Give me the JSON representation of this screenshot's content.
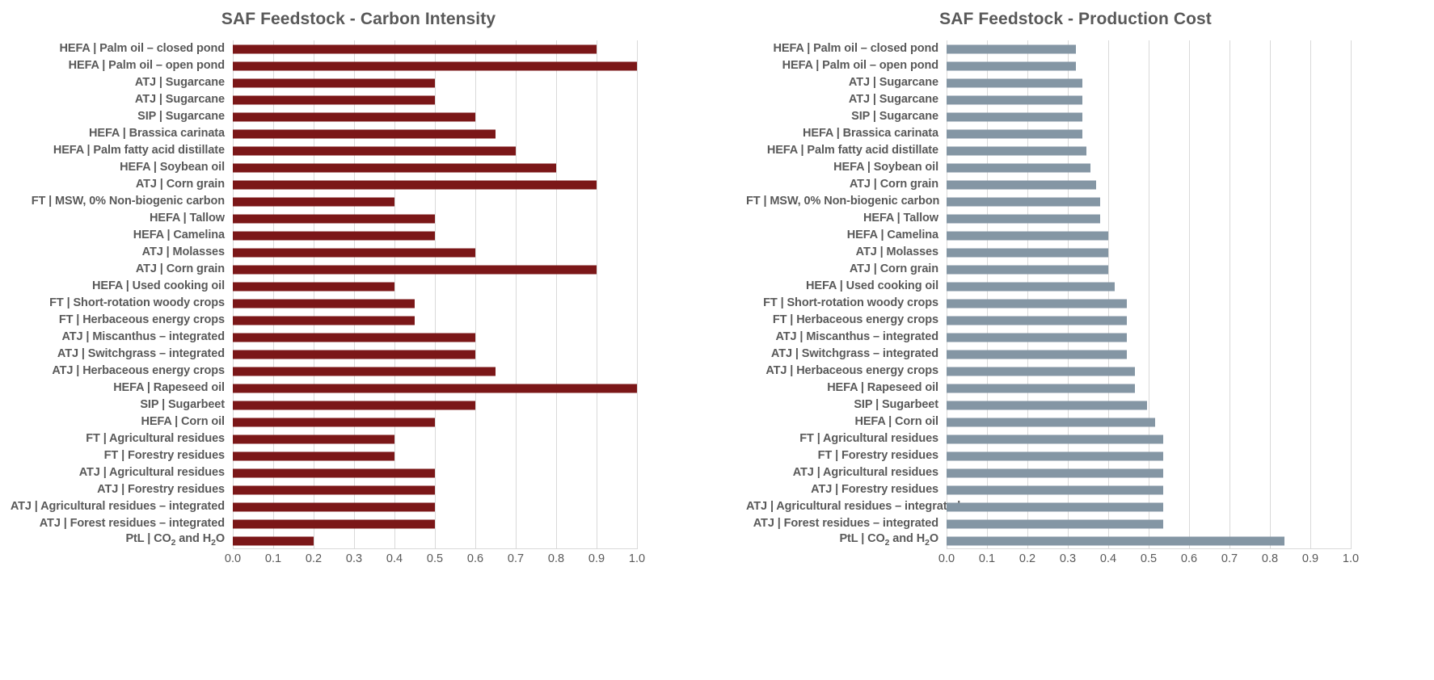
{
  "charts": [
    {
      "id": "carbon-intensity",
      "title": "SAF Feedstock - Carbon Intensity",
      "bar_color": "#7b1718",
      "xticks": [
        "0.0",
        "0.1",
        "0.2",
        "0.3",
        "0.4",
        "0.5",
        "0.6",
        "0.7",
        "0.8",
        "0.9",
        "1.0"
      ],
      "categories": [
        "HEFA | Palm oil – closed pond",
        "HEFA | Palm oil – open pond",
        "ATJ | Sugarcane",
        "ATJ | Sugarcane",
        "SIP | Sugarcane",
        "HEFA | Brassica carinata",
        "HEFA | Palm fatty acid distillate",
        "HEFA | Soybean oil",
        "ATJ | Corn grain",
        "FT | MSW, 0% Non-biogenic carbon",
        "HEFA | Tallow",
        "HEFA | Camelina",
        "ATJ | Molasses",
        "ATJ | Corn grain",
        "HEFA | Used cooking oil",
        "FT | Short-rotation woody crops",
        "FT | Herbaceous energy crops",
        "ATJ | Miscanthus – integrated",
        "ATJ | Switchgrass – integrated",
        "ATJ | Herbaceous energy crops",
        "HEFA | Rapeseed oil",
        "SIP | Sugarbeet",
        "HEFA | Corn oil",
        "FT | Agricultural residues",
        "FT | Forestry residues",
        "ATJ | Agricultural residues",
        "ATJ | Forestry residues",
        "ATJ | Agricultural residues – integrated",
        "ATJ | Forest residues – integrated",
        "PtL | CO₂ and H₂O"
      ],
      "values": [
        0.9,
        1.0,
        0.5,
        0.5,
        0.6,
        0.65,
        0.7,
        0.8,
        0.9,
        0.4,
        0.5,
        0.5,
        0.6,
        0.9,
        0.4,
        0.45,
        0.45,
        0.6,
        0.6,
        0.65,
        1.0,
        0.6,
        0.5,
        0.4,
        0.4,
        0.5,
        0.5,
        0.5,
        0.5,
        0.2
      ]
    },
    {
      "id": "production-cost",
      "title": "SAF Feedstock - Production Cost",
      "bar_color": "#8496a4",
      "xticks": [
        "0.0",
        "0.1",
        "0.2",
        "0.3",
        "0.4",
        "0.5",
        "0.6",
        "0.7",
        "0.8",
        "0.9",
        "1.0"
      ],
      "categories": [
        "HEFA | Palm oil – closed pond",
        "HEFA | Palm oil – open pond",
        "ATJ | Sugarcane",
        "ATJ | Sugarcane",
        "SIP | Sugarcane",
        "HEFA | Brassica carinata",
        "HEFA | Palm fatty acid distillate",
        "HEFA | Soybean oil",
        "ATJ | Corn grain",
        "FT | MSW, 0% Non-biogenic carbon",
        "HEFA | Tallow",
        "HEFA | Camelina",
        "ATJ | Molasses",
        "ATJ | Corn grain",
        "HEFA | Used cooking oil",
        "FT | Short-rotation woody crops",
        "FT | Herbaceous energy crops",
        "ATJ | Miscanthus – integrated",
        "ATJ | Switchgrass – integrated",
        "ATJ | Herbaceous energy crops",
        "HEFA | Rapeseed oil",
        "SIP | Sugarbeet",
        "HEFA | Corn oil",
        "FT | Agricultural residues",
        "FT | Forestry residues",
        "ATJ | Agricultural residues",
        "ATJ | Forestry residues",
        "ATJ | Agricultural residues – integrated",
        "ATJ | Forest residues – integrated",
        "PtL | CO₂ and H₂O"
      ],
      "values": [
        0.32,
        0.32,
        0.335,
        0.335,
        0.335,
        0.335,
        0.345,
        0.355,
        0.37,
        0.38,
        0.38,
        0.4,
        0.4,
        0.4,
        0.415,
        0.445,
        0.445,
        0.445,
        0.445,
        0.465,
        0.465,
        0.495,
        0.515,
        0.535,
        0.535,
        0.535,
        0.535,
        0.535,
        0.535,
        0.835
      ]
    }
  ],
  "chart_data": [
    {
      "type": "bar",
      "orientation": "horizontal",
      "title": "SAF Feedstock - Carbon Intensity",
      "xlabel": "",
      "ylabel": "",
      "xlim": [
        0.0,
        1.0
      ],
      "grid": true,
      "legend": "none",
      "series_color": "#7b1718",
      "categories": [
        "HEFA | Palm oil – closed pond",
        "HEFA | Palm oil – open pond",
        "ATJ | Sugarcane",
        "ATJ | Sugarcane",
        "SIP | Sugarcane",
        "HEFA | Brassica carinata",
        "HEFA | Palm fatty acid distillate",
        "HEFA | Soybean oil",
        "ATJ | Corn grain",
        "FT | MSW, 0% Non-biogenic carbon",
        "HEFA | Tallow",
        "HEFA | Camelina",
        "ATJ | Molasses",
        "ATJ | Corn grain",
        "HEFA | Used cooking oil",
        "FT | Short-rotation woody crops",
        "FT | Herbaceous energy crops",
        "ATJ | Miscanthus – integrated",
        "ATJ | Switchgrass – integrated",
        "ATJ | Herbaceous energy crops",
        "HEFA | Rapeseed oil",
        "SIP | Sugarbeet",
        "HEFA | Corn oil",
        "FT | Agricultural residues",
        "FT | Forestry residues",
        "ATJ | Agricultural residues",
        "ATJ | Forestry residues",
        "ATJ | Agricultural residues – integrated",
        "ATJ | Forest residues – integrated",
        "PtL | CO₂ and H₂O"
      ],
      "values": [
        0.9,
        1.0,
        0.5,
        0.5,
        0.6,
        0.65,
        0.7,
        0.8,
        0.9,
        0.4,
        0.5,
        0.5,
        0.6,
        0.9,
        0.4,
        0.45,
        0.45,
        0.6,
        0.6,
        0.65,
        1.0,
        0.6,
        0.5,
        0.4,
        0.4,
        0.5,
        0.5,
        0.5,
        0.5,
        0.2
      ],
      "xticks": [
        0.0,
        0.1,
        0.2,
        0.3,
        0.4,
        0.5,
        0.6,
        0.7,
        0.8,
        0.9,
        1.0
      ]
    },
    {
      "type": "bar",
      "orientation": "horizontal",
      "title": "SAF Feedstock - Production Cost",
      "xlabel": "",
      "ylabel": "",
      "xlim": [
        0.0,
        1.0
      ],
      "grid": true,
      "legend": "none",
      "series_color": "#8496a4",
      "categories": [
        "HEFA | Palm oil – closed pond",
        "HEFA | Palm oil – open pond",
        "ATJ | Sugarcane",
        "ATJ | Sugarcane",
        "SIP | Sugarcane",
        "HEFA | Brassica carinata",
        "HEFA | Palm fatty acid distillate",
        "HEFA | Soybean oil",
        "ATJ | Corn grain",
        "FT | MSW, 0% Non-biogenic carbon",
        "HEFA | Tallow",
        "HEFA | Camelina",
        "ATJ | Molasses",
        "ATJ | Corn grain",
        "HEFA | Used cooking oil",
        "FT | Short-rotation woody crops",
        "FT | Herbaceous energy crops",
        "ATJ | Miscanthus – integrated",
        "ATJ | Switchgrass – integrated",
        "ATJ | Herbaceous energy crops",
        "HEFA | Rapeseed oil",
        "SIP | Sugarbeet",
        "HEFA | Corn oil",
        "FT | Agricultural residues",
        "FT | Forestry residues",
        "ATJ | Agricultural residues",
        "ATJ | Forestry residues",
        "ATJ | Agricultural residues – integrated",
        "ATJ | Forest residues – integrated",
        "PtL | CO₂ and H₂O"
      ],
      "values": [
        0.32,
        0.32,
        0.335,
        0.335,
        0.335,
        0.335,
        0.345,
        0.355,
        0.37,
        0.38,
        0.38,
        0.4,
        0.4,
        0.4,
        0.415,
        0.445,
        0.445,
        0.445,
        0.445,
        0.465,
        0.465,
        0.495,
        0.515,
        0.535,
        0.535,
        0.535,
        0.535,
        0.535,
        0.535,
        0.835
      ],
      "xticks": [
        0.0,
        0.1,
        0.2,
        0.3,
        0.4,
        0.5,
        0.6,
        0.7,
        0.8,
        0.9,
        1.0
      ]
    }
  ]
}
